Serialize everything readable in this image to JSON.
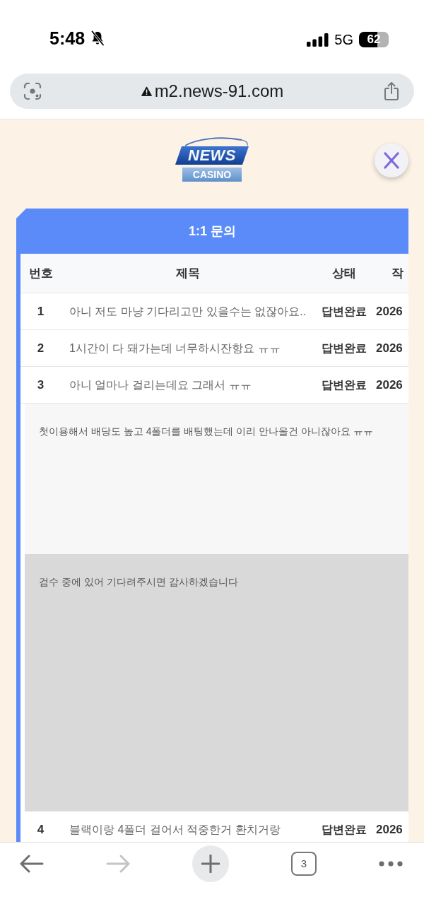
{
  "status_bar": {
    "time": "5:48",
    "silent": true,
    "network": "5G",
    "battery": "62"
  },
  "address_bar": {
    "url": "m2.news-91.com",
    "not_secure": true
  },
  "logo": {
    "title": "NEWS",
    "subtitle": "CASINO"
  },
  "panel": {
    "title": "1:1 문의",
    "columns": [
      "번호",
      "제목",
      "상태",
      "작"
    ],
    "rows": [
      {
        "number": "1",
        "title": "아니 저도 마냥 기다리고만 있을수는 없잖아요..",
        "status": "답변완료",
        "date": "2026",
        "expanded": false
      },
      {
        "number": "2",
        "title": "1시간이 다 돼가는데 너무하시잔항요 ㅠㅠ",
        "status": "답변완료",
        "date": "2026",
        "expanded": false
      },
      {
        "number": "3",
        "title": "아니 얼마나 걸리는데요 그래서 ㅠㅠ",
        "status": "답변완료",
        "date": "2026",
        "expanded": true,
        "question": "첫이용해서 배당도 높고 4폴더를 배팅했는데 이리 안나올건 아니잖아요 ㅠㅠ",
        "answer": "검수 중에 있어 기다려주시면 감사하겠습니다"
      },
      {
        "number": "4",
        "title": "블랙이랑 4폴더 걸어서 적중한거 환치거랑",
        "status": "답변완료",
        "date": "2026",
        "expanded": false
      }
    ]
  },
  "toolbar": [
    {
      "kind": "back",
      "disabled": false
    },
    {
      "kind": "forward",
      "disabled": true
    },
    {
      "kind": "new_tab"
    },
    {
      "kind": "tabs",
      "label": "3"
    },
    {
      "kind": "more"
    }
  ]
}
